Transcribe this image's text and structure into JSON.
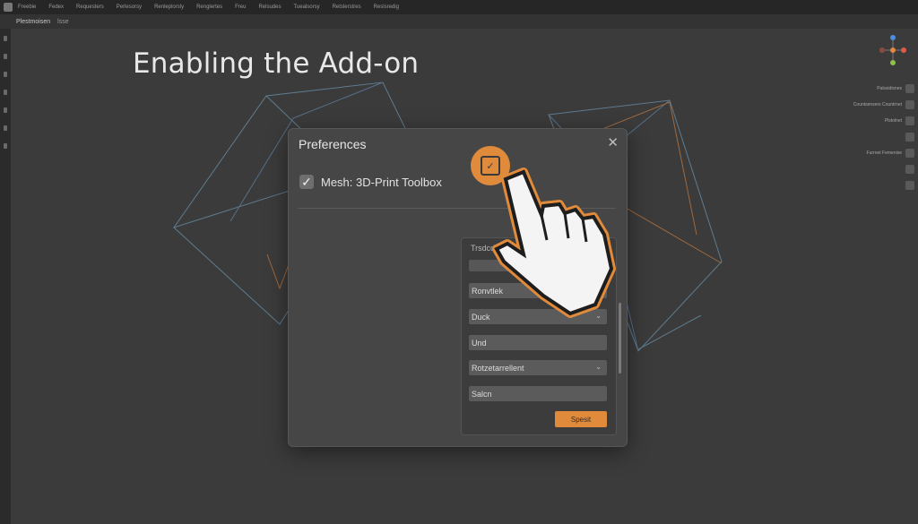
{
  "menubar": {
    "items": [
      "Freebie",
      "Fedex",
      "Requesters",
      "Perlesorsy",
      "Renleplorsly",
      "Renglertes",
      "Freu",
      "Relsudes",
      "Tuealsorsy",
      "Retslerstres",
      "Reslsredig"
    ]
  },
  "toolbar": {
    "label": "Plestmoisen",
    "sub_label": "lsse"
  },
  "heading": "Enabling the Add-on",
  "right_panel": {
    "items": [
      {
        "label": "Palssidisnes",
        "icon": "panel-icon"
      },
      {
        "label": "Countsensers Countrnet",
        "icon": "refresh-icon"
      },
      {
        "label": "Plstolnet",
        "icon": "panel-icon"
      },
      {
        "label": "",
        "icon": "sphere-icon"
      },
      {
        "label": "Furrnet Femenise",
        "icon": "wrench-icon"
      },
      {
        "label": "",
        "icon": "grid-icon"
      },
      {
        "label": "",
        "icon": "shading-icon"
      }
    ]
  },
  "gizmo": {
    "x_color": "#e05a4a",
    "y_color": "#8cc04a",
    "z_color": "#4a8fe0"
  },
  "dialog": {
    "title": "Preferences",
    "close_symbol": "✕",
    "addon": {
      "checked_symbol": "✓",
      "label": "Mesh: 3D-Print Toolbox"
    },
    "toggle_symbol": "✓",
    "subpanel": {
      "title": "Trsdcdo",
      "fields": [
        {
          "label": "Ronvtlek",
          "has_dropdown": false
        },
        {
          "label": "Duck",
          "has_dropdown": true
        },
        {
          "label": "Und",
          "has_dropdown": false
        },
        {
          "label": "Rotzetarrellent",
          "has_dropdown": true
        },
        {
          "label": "Salcn",
          "has_dropdown": false
        }
      ],
      "button_label": "Spesit"
    }
  },
  "colors": {
    "accent": "#e08a3c",
    "background": "#3b3b3b",
    "dialog": "#464646",
    "wireframe_blue": "#5e7c8f",
    "wireframe_orange": "#a06a3f"
  }
}
